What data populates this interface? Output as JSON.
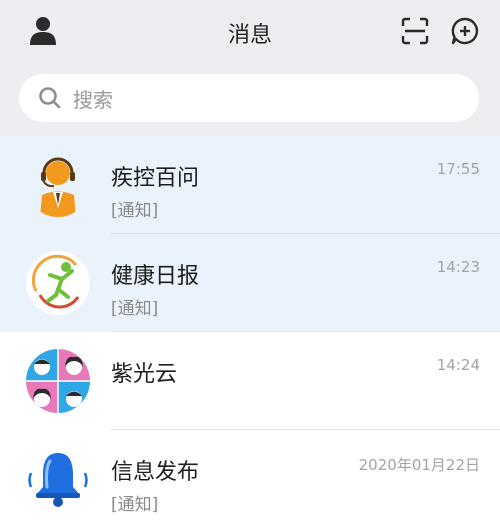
{
  "header": {
    "title": "消息",
    "left_icon": "profile-icon",
    "right_icons": [
      "scan-icon",
      "add-chat-icon"
    ]
  },
  "search": {
    "placeholder": "搜索",
    "icon": "search-icon"
  },
  "conversations": [
    {
      "name": "疾控百问",
      "preview": "[通知]",
      "time": "17:55",
      "pinned": true,
      "avatar": "customer-service-avatar"
    },
    {
      "name": "健康日报",
      "preview": "[通知]",
      "time": "14:23",
      "pinned": true,
      "avatar": "health-daily-logo"
    },
    {
      "name": "紫光云",
      "preview": "",
      "time": "14:24",
      "pinned": false,
      "avatar": "group-avatar"
    },
    {
      "name": "信息发布",
      "preview": "[通知]",
      "time": "2020年01月22日",
      "pinned": false,
      "avatar": "bell-avatar"
    }
  ],
  "colors": {
    "header_bg": "#ededf2",
    "pinned_bg": "#eaf3fb",
    "accent_orange": "#f39a1e",
    "bell_blue": "#1f6fe0"
  }
}
